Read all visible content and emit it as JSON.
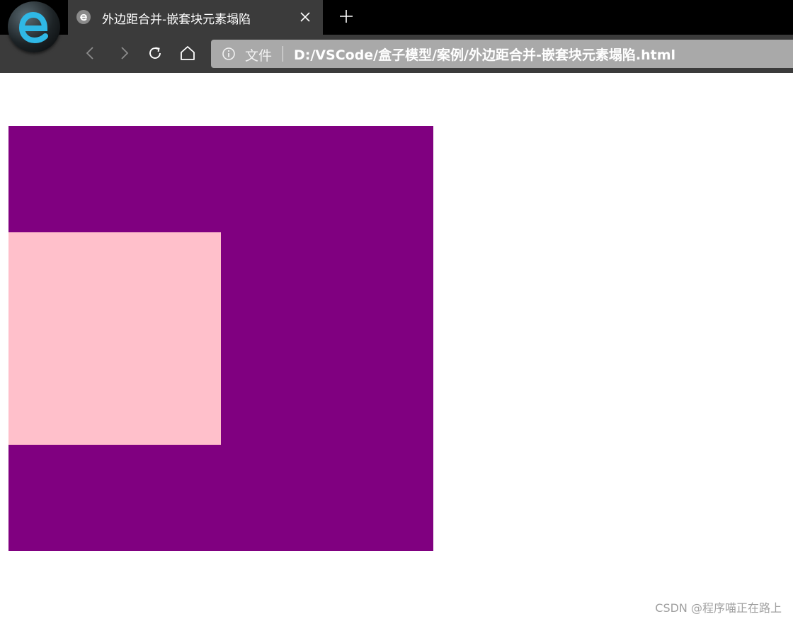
{
  "browser": {
    "logo_icon": "edge-legacy-logo-icon",
    "tab": {
      "title": "外边距合并-嵌套块元素塌陷",
      "favicon": "page-favicon-icon",
      "close_icon": "close-icon"
    },
    "new_tab_icon": "plus-icon",
    "toolbar": {
      "back_icon": "chevron-left-icon",
      "forward_icon": "chevron-right-icon",
      "refresh_icon": "refresh-icon",
      "home_icon": "home-icon"
    },
    "address_bar": {
      "info_icon": "info-icon",
      "scheme_label": "文件",
      "url": "D:/VSCode/盒子模型/案例/外边距合并-嵌套块元素塌陷.html"
    }
  },
  "page": {
    "outer_box_color": "#800080",
    "inner_box_color": "#ffc0cb"
  },
  "watermark": {
    "text": "CSDN @程序喵正在路上"
  }
}
